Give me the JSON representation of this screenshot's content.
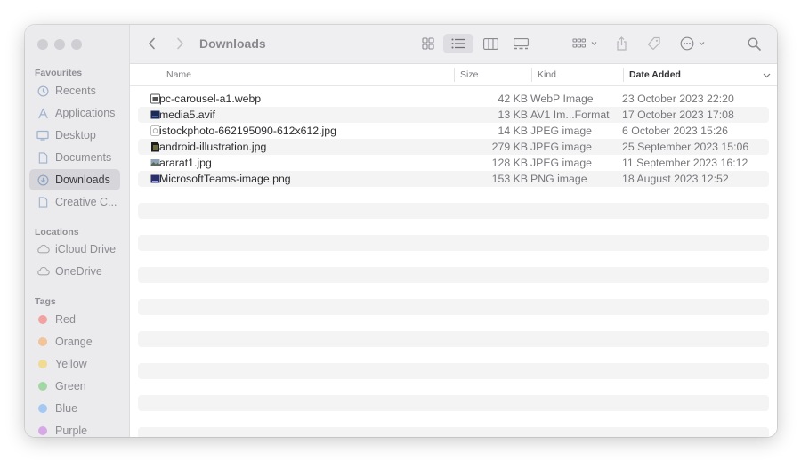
{
  "toolbar": {
    "title": "Downloads"
  },
  "sidebar": {
    "favourites_title": "Favourites",
    "favourites": [
      {
        "label": "Recents",
        "icon": "clock-icon"
      },
      {
        "label": "Applications",
        "icon": "applications-icon"
      },
      {
        "label": "Desktop",
        "icon": "desktop-icon"
      },
      {
        "label": "Documents",
        "icon": "document-icon"
      },
      {
        "label": "Downloads",
        "icon": "download-icon"
      },
      {
        "label": "Creative C...",
        "icon": "document-icon"
      }
    ],
    "locations_title": "Locations",
    "locations": [
      {
        "label": "iCloud Drive",
        "icon": "cloud-icon"
      },
      {
        "label": "OneDrive",
        "icon": "cloud-icon"
      }
    ],
    "tags_title": "Tags",
    "tags": [
      {
        "label": "Red",
        "color": "#f0a3a0"
      },
      {
        "label": "Orange",
        "color": "#f3c39a"
      },
      {
        "label": "Yellow",
        "color": "#efdb92"
      },
      {
        "label": "Green",
        "color": "#a3d7a6"
      },
      {
        "label": "Blue",
        "color": "#a4c8f2"
      },
      {
        "label": "Purple",
        "color": "#d6a9e6"
      }
    ]
  },
  "columns": {
    "name": "Name",
    "size": "Size",
    "kind": "Kind",
    "date": "Date Added"
  },
  "files": [
    {
      "name": "pc-carousel-a1.webp",
      "size": "42 KB",
      "kind": "WebP Image",
      "date": "23 October 2023 22:20"
    },
    {
      "name": "media5.avif",
      "size": "13 KB",
      "kind": "AV1 Im...Format",
      "date": "17 October 2023 17:08"
    },
    {
      "name": "istockphoto-662195090-612x612.jpg",
      "size": "14 KB",
      "kind": "JPEG image",
      "date": "6 October 2023 15:26"
    },
    {
      "name": "android-illustration.jpg",
      "size": "279 KB",
      "kind": "JPEG image",
      "date": "25 September 2023 15:06"
    },
    {
      "name": "ararat1.jpg",
      "size": "128 KB",
      "kind": "JPEG image",
      "date": "11 September 2023 16:12"
    },
    {
      "name": "MicrosoftTeams-image.png",
      "size": "153 KB",
      "kind": "PNG image",
      "date": "18 August 2023 12:52"
    }
  ]
}
